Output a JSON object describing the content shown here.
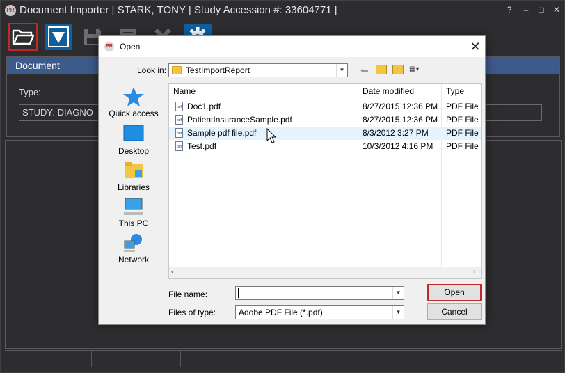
{
  "window": {
    "title": "Document Importer | STARK, TONY | Study Accession #: 33604771 |",
    "logo_text": "PR",
    "controls": [
      "?",
      "–",
      "□",
      "✕"
    ]
  },
  "toolbar": {
    "items": [
      {
        "name": "open-folder-button",
        "icon": "folder-open-icon",
        "selected": true
      },
      {
        "name": "download-button",
        "icon": "download-triangle-icon"
      },
      {
        "name": "save-button",
        "icon": "save-disk-icon",
        "disabled": true
      },
      {
        "name": "report-button",
        "icon": "report-icon",
        "disabled": true
      },
      {
        "name": "delete-button",
        "icon": "x-icon",
        "disabled": true
      },
      {
        "name": "settings-button",
        "icon": "gear-icon"
      }
    ]
  },
  "document_panel": {
    "header": "Document",
    "type_label": "Type:",
    "type_value": "STUDY:   DIAGNO"
  },
  "dialog": {
    "title": "Open",
    "logo_text": "PR",
    "look_in_label": "Look in:",
    "look_in_value": "TestImportReport",
    "places": [
      "Quick access",
      "Desktop",
      "Libraries",
      "This PC",
      "Network"
    ],
    "columns": [
      "Name",
      "Date modified",
      "Type"
    ],
    "files": [
      {
        "name": "Doc1.pdf",
        "date": "8/27/2015 12:36 PM",
        "type": "PDF File"
      },
      {
        "name": "PatientInsuranceSample.pdf",
        "date": "8/27/2015 12:36 PM",
        "type": "PDF File"
      },
      {
        "name": "Sample pdf file.pdf",
        "date": "8/3/2012 3:27 PM",
        "type": "PDF File"
      },
      {
        "name": "Test.pdf",
        "date": "10/3/2012 4:16 PM",
        "type": "PDF File"
      }
    ],
    "highlighted_row": 2,
    "file_name_label": "File name:",
    "file_name_value": "",
    "file_type_label": "Files of type:",
    "file_type_value": "Adobe PDF File (*.pdf)",
    "open_label": "Open",
    "cancel_label": "Cancel",
    "pdf_icon_text": "pdf"
  },
  "colors": {
    "accent": "#c0282a",
    "header_blue": "#3c5a8a",
    "tool_blue": "#0e5fa0"
  }
}
